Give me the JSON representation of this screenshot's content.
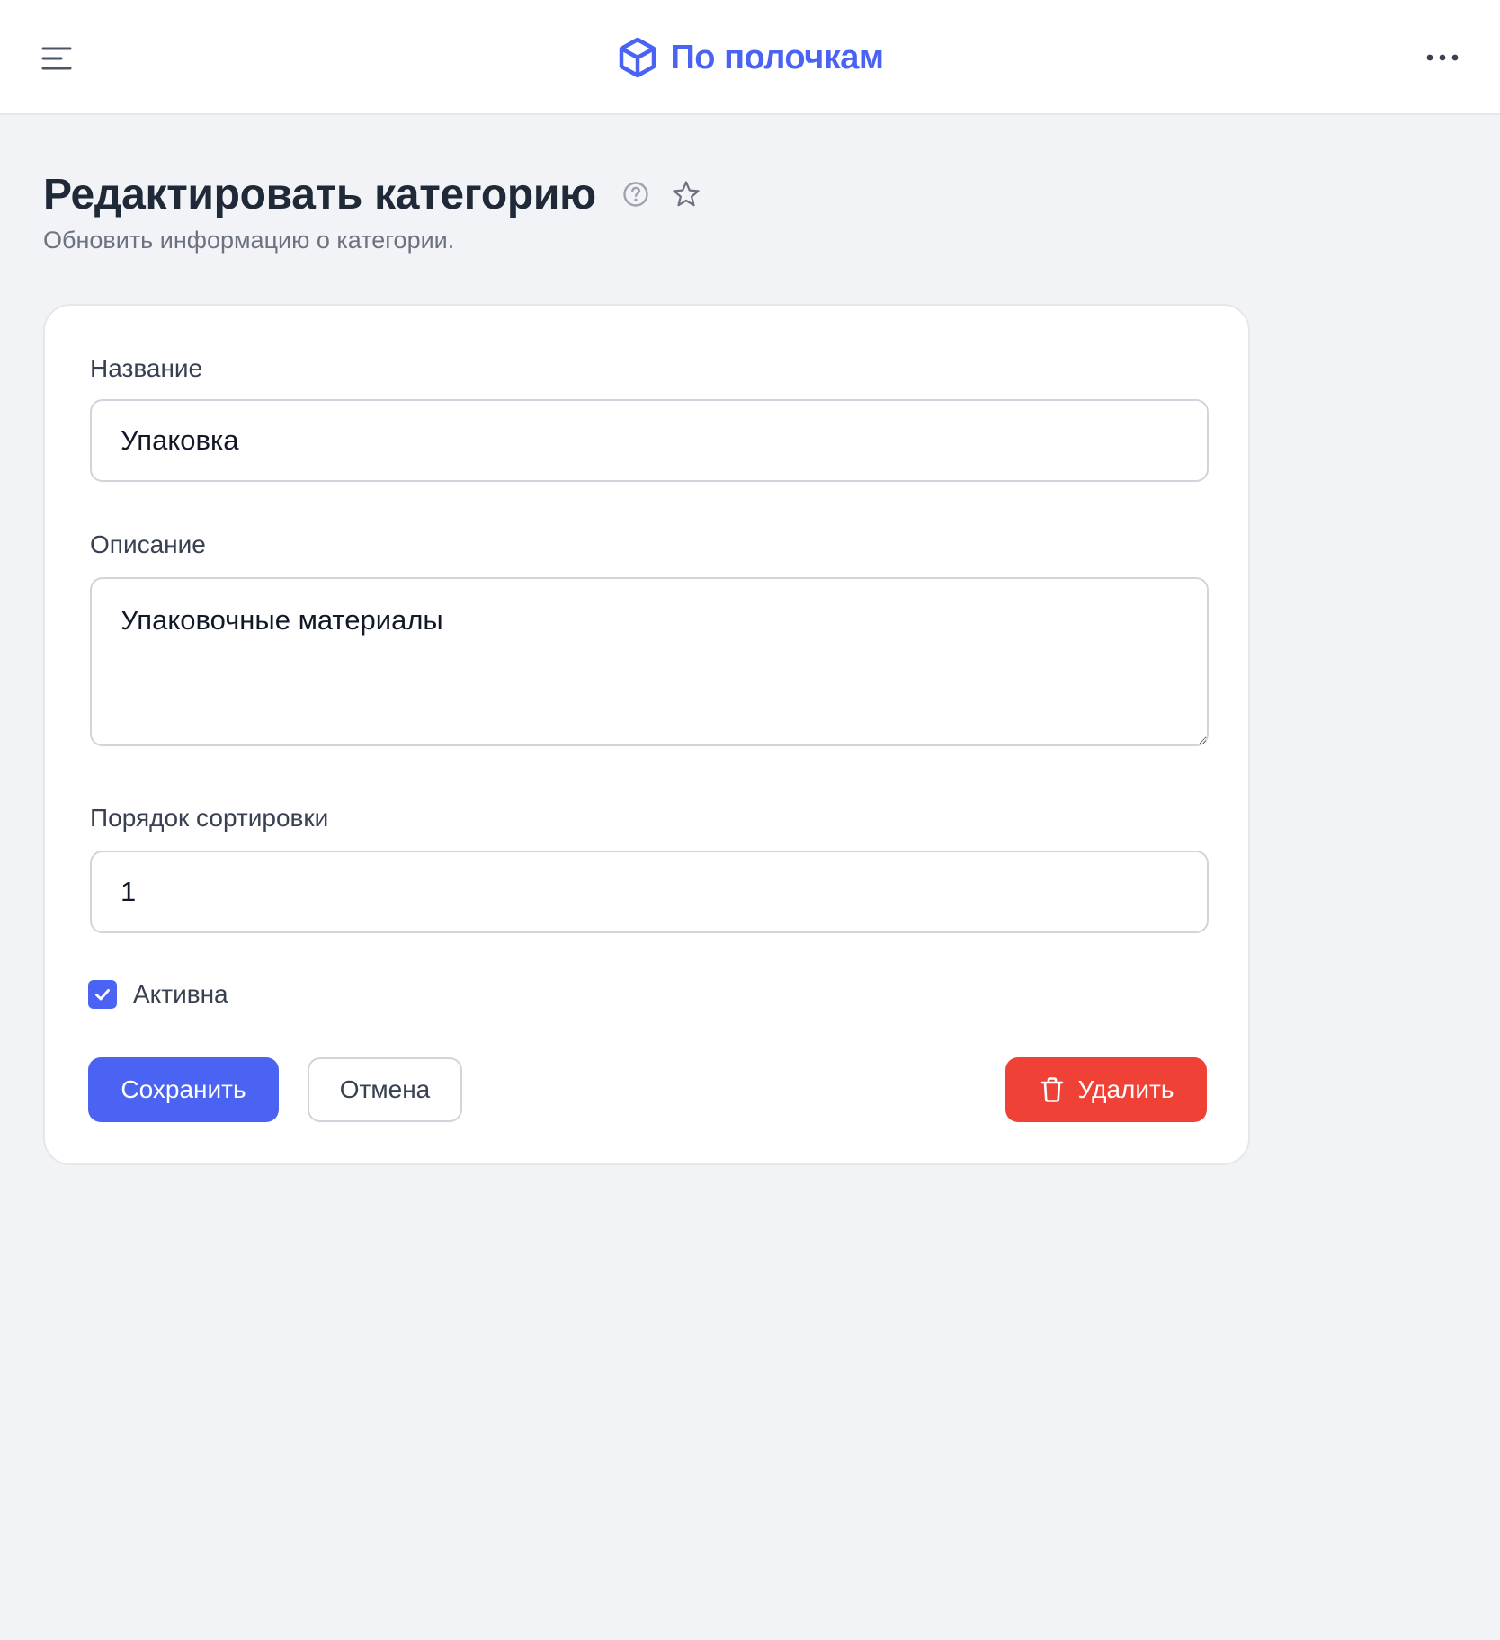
{
  "header": {
    "brand_name": "По полочкам",
    "brand_icon": "box-icon",
    "menu_icon": "hamburger-menu-icon",
    "more_icon": "more-horizontal-icon",
    "brand_color": "#4a63f3"
  },
  "page": {
    "title": "Редактировать категорию",
    "subtitle": "Обновить информацию о категории.",
    "help_icon": "help-circle-icon",
    "favorite_icon": "star-icon"
  },
  "form": {
    "name": {
      "label": "Название",
      "value": "Упаковка"
    },
    "description": {
      "label": "Описание",
      "value": "Упаковочные материалы"
    },
    "sort_order": {
      "label": "Порядок сортировки",
      "value": "1"
    },
    "active": {
      "label": "Активна",
      "checked": true
    }
  },
  "actions": {
    "save_label": "Сохранить",
    "cancel_label": "Отмена",
    "delete_label": "Удалить",
    "delete_icon": "trash-icon",
    "primary_color": "#4a63f3",
    "danger_color": "#ef4136"
  }
}
